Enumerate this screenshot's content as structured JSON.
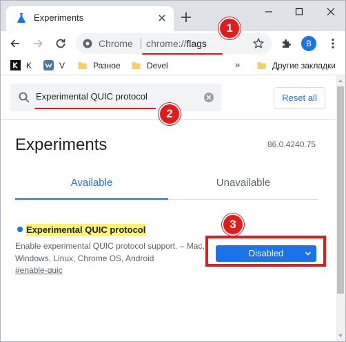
{
  "tab": {
    "title": "Experiments"
  },
  "omnibox": {
    "site": "Chrome",
    "url_scheme": "chrome://",
    "url_path": "flags"
  },
  "account": {
    "initial": "B"
  },
  "bookmarks": [
    {
      "label": "K",
      "icon": "k-letter-icon"
    },
    {
      "label": "V",
      "icon": "vk-logo-icon"
    },
    {
      "label": "Разное",
      "icon": "folder-icon"
    },
    {
      "label": "Devel",
      "icon": "folder-icon"
    }
  ],
  "bookmarks_more": "»",
  "other_bookmarks": "Другие закладки",
  "search": {
    "value": "Experimental QUIC protocol",
    "reset_label": "Reset all"
  },
  "page": {
    "title": "Experiments",
    "version": "86.0.4240.75"
  },
  "tabs": {
    "available": "Available",
    "unavailable": "Unavailable"
  },
  "flag": {
    "title": "Experimental QUIC protocol",
    "description": "Enable experimental QUIC protocol support. – Mac, Windows, Linux, Chrome OS, Android",
    "link": "#enable-quic",
    "selected": "Disabled"
  },
  "annotations": {
    "step1": "1",
    "step2": "2",
    "step3": "3"
  },
  "colors": {
    "accent": "#1a73e8",
    "annotation": "#e01c1c",
    "highlight": "#fdf36f"
  }
}
